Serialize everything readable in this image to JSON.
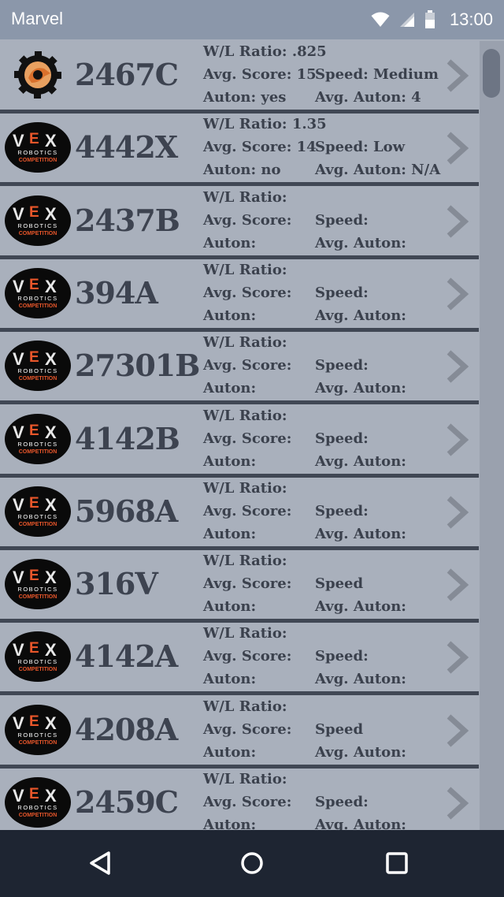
{
  "status_bar": {
    "app_title": "Marvel",
    "time": "13:00"
  },
  "logo_text": {
    "vex_v": "V",
    "vex_e": "E",
    "vex_x": "X",
    "robotics": "ROBOTICS",
    "competition": "COMPETITION"
  },
  "teams": [
    {
      "logo": "gear-logo",
      "name": "2467C",
      "wl": "W/L Ratio: .825",
      "avg": "Avg. Score: 15",
      "auton": "Auton: yes",
      "speed": "Speed: Medium",
      "avg_auton": "Avg. Auton: 4"
    },
    {
      "logo": "vex-logo",
      "name": "4442X",
      "wl": "W/L Ratio: 1.35",
      "avg": "Avg. Score: 14",
      "auton": "Auton: no",
      "speed": "Speed: Low",
      "avg_auton": "Avg. Auton: N/A"
    },
    {
      "logo": "vex-logo",
      "name": "2437B",
      "wl": "W/L Ratio:",
      "avg": "Avg. Score:",
      "auton": "Auton:",
      "speed": "Speed:",
      "avg_auton": "Avg. Auton:"
    },
    {
      "logo": "vex-logo",
      "name": "394A",
      "wl": "W/L Ratio:",
      "avg": "Avg. Score:",
      "auton": "Auton:",
      "speed": "Speed:",
      "avg_auton": "Avg. Auton:"
    },
    {
      "logo": "vex-logo",
      "name": "27301B",
      "wl": "W/L Ratio:",
      "avg": "Avg. Score:",
      "auton": "Auton:",
      "speed": "Speed:",
      "avg_auton": "Avg. Auton:"
    },
    {
      "logo": "vex-logo",
      "name": "4142B",
      "wl": "W/L Ratio:",
      "avg": "Avg. Score:",
      "auton": "Auton:",
      "speed": "Speed:",
      "avg_auton": "Avg. Auton:"
    },
    {
      "logo": "vex-logo",
      "name": "5968A",
      "wl": "W/L Ratio:",
      "avg": "Avg. Score:",
      "auton": "Auton:",
      "speed": "Speed:",
      "avg_auton": "Avg. Auton:"
    },
    {
      "logo": "vex-logo",
      "name": "316V",
      "wl": "W/L Ratio:",
      "avg": "Avg. Score:",
      "auton": "Auton:",
      "speed": "Speed",
      "avg_auton": "Avg. Auton:"
    },
    {
      "logo": "vex-logo",
      "name": "4142A",
      "wl": "W/L Ratio:",
      "avg": "Avg. Score:",
      "auton": "Auton:",
      "speed": "Speed:",
      "avg_auton": "Avg. Auton:"
    },
    {
      "logo": "vex-logo",
      "name": "4208A",
      "wl": "W/L Ratio:",
      "avg": "Avg. Score:",
      "auton": "Auton:",
      "speed": "Speed",
      "avg_auton": "Avg. Auton:"
    },
    {
      "logo": "vex-logo",
      "name": "2459C",
      "wl": "W/L Ratio:",
      "avg": "Avg. Score:",
      "auton": "Auton:",
      "speed": "Speed:",
      "avg_auton": "Avg. Auton:"
    }
  ],
  "colors": {
    "accent_orange": "#e8562a",
    "row_bg": "#a9b0bc",
    "divider": "#404754",
    "nav_bg": "#1e2532"
  },
  "nav_bar": {
    "back": "back-icon",
    "home": "home-icon",
    "recents": "recents-icon"
  }
}
